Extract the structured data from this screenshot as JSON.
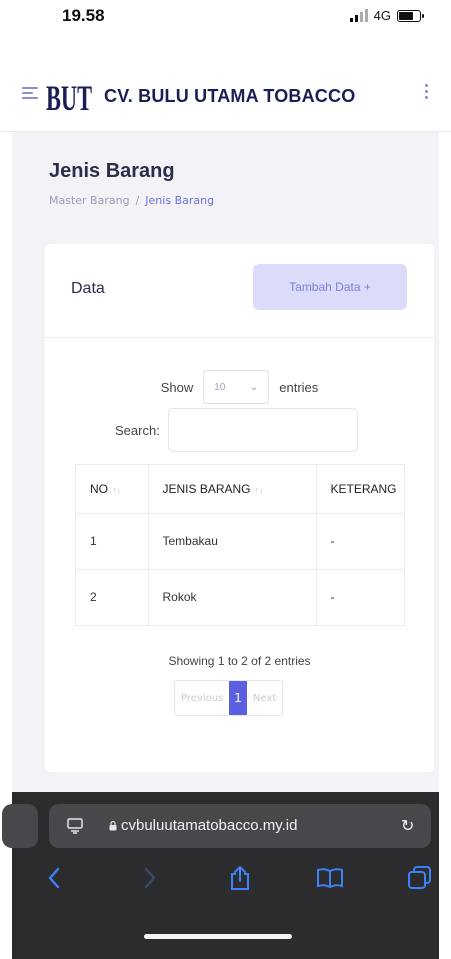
{
  "status_bar": {
    "time": "19.58",
    "network": "4G",
    "battery_level": 0.7
  },
  "header": {
    "logo_text": "BUT",
    "brand_name": "CV. BULU UTAMA TOBACCO",
    "menu_icon": "hamburger-icon",
    "more_icon": "kebab-icon",
    "brand_color": "#1a1e55"
  },
  "page": {
    "title": "Jenis Barang",
    "breadcrumb": [
      {
        "label": "Master Barang"
      },
      {
        "label": "/"
      },
      {
        "label": "Jenis Barang"
      }
    ]
  },
  "card": {
    "title": "Data",
    "add_button_label": "Tambah Data +",
    "accent_color": "#5b5fe0"
  },
  "table_controls": {
    "show_label": "Show",
    "entries_value": "10",
    "entries_label": "entries",
    "search_label": "Search:",
    "search_value": ""
  },
  "table": {
    "columns": [
      "NO",
      "JENIS BARANG",
      "KETERANG"
    ],
    "rows": [
      {
        "no": "1",
        "jenis": "Tembakau",
        "keterangan": "-"
      },
      {
        "no": "2",
        "jenis": "Rokok",
        "keterangan": "-"
      }
    ]
  },
  "pagination": {
    "info": "Showing 1 to 2 of 2 entries",
    "previous_label": "Previous",
    "current_page": "1",
    "next_label": "Next"
  },
  "browser": {
    "url": "cvbuluutamatobacco.my.id",
    "icons": [
      "reader-icon",
      "lock-icon",
      "reload-icon",
      "back-icon",
      "forward-icon",
      "share-icon",
      "bookmarks-icon",
      "tabs-icon"
    ]
  }
}
